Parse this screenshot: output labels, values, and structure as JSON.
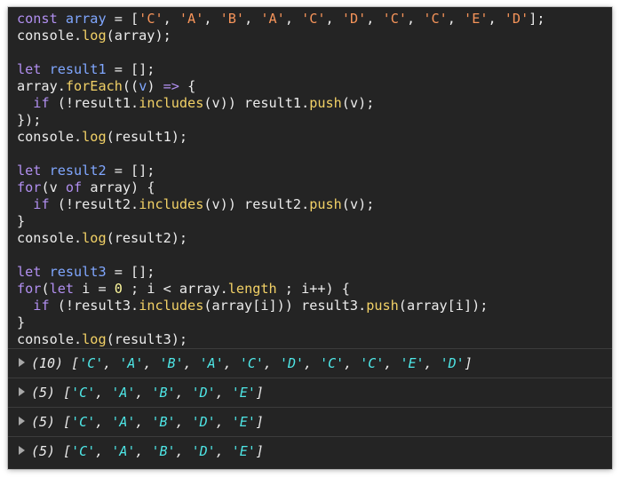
{
  "code_lines": [
    [
      {
        "t": "kw",
        "v": "const "
      },
      {
        "t": "var",
        "v": "array"
      },
      {
        "t": "txt",
        "v": " = ["
      },
      {
        "t": "str",
        "v": "'C'"
      },
      {
        "t": "txt",
        "v": ", "
      },
      {
        "t": "str",
        "v": "'A'"
      },
      {
        "t": "txt",
        "v": ", "
      },
      {
        "t": "str",
        "v": "'B'"
      },
      {
        "t": "txt",
        "v": ", "
      },
      {
        "t": "str",
        "v": "'A'"
      },
      {
        "t": "txt",
        "v": ", "
      },
      {
        "t": "str",
        "v": "'C'"
      },
      {
        "t": "txt",
        "v": ", "
      },
      {
        "t": "str",
        "v": "'D'"
      },
      {
        "t": "txt",
        "v": ", "
      },
      {
        "t": "str",
        "v": "'C'"
      },
      {
        "t": "txt",
        "v": ", "
      },
      {
        "t": "str",
        "v": "'C'"
      },
      {
        "t": "txt",
        "v": ", "
      },
      {
        "t": "str",
        "v": "'E'"
      },
      {
        "t": "txt",
        "v": ", "
      },
      {
        "t": "str",
        "v": "'D'"
      },
      {
        "t": "txt",
        "v": "];"
      }
    ],
    [
      {
        "t": "txt",
        "v": "console."
      },
      {
        "t": "fn",
        "v": "log"
      },
      {
        "t": "txt",
        "v": "(array);"
      }
    ],
    [],
    [
      {
        "t": "kw",
        "v": "let "
      },
      {
        "t": "var",
        "v": "result1"
      },
      {
        "t": "txt",
        "v": " = [];"
      }
    ],
    [
      {
        "t": "txt",
        "v": "array."
      },
      {
        "t": "fn",
        "v": "forEach"
      },
      {
        "t": "txt",
        "v": "(("
      },
      {
        "t": "var",
        "v": "v"
      },
      {
        "t": "txt",
        "v": ") "
      },
      {
        "t": "kw",
        "v": "=>"
      },
      {
        "t": "txt",
        "v": " {"
      }
    ],
    [
      {
        "t": "txt",
        "v": "  "
      },
      {
        "t": "kw",
        "v": "if"
      },
      {
        "t": "txt",
        "v": " (!result1."
      },
      {
        "t": "fn",
        "v": "includes"
      },
      {
        "t": "txt",
        "v": "(v)) result1."
      },
      {
        "t": "fn",
        "v": "push"
      },
      {
        "t": "txt",
        "v": "(v);"
      }
    ],
    [
      {
        "t": "txt",
        "v": "});"
      }
    ],
    [
      {
        "t": "txt",
        "v": "console."
      },
      {
        "t": "fn",
        "v": "log"
      },
      {
        "t": "txt",
        "v": "(result1);"
      }
    ],
    [],
    [
      {
        "t": "kw",
        "v": "let "
      },
      {
        "t": "var",
        "v": "result2"
      },
      {
        "t": "txt",
        "v": " = [];"
      }
    ],
    [
      {
        "t": "kw",
        "v": "for"
      },
      {
        "t": "txt",
        "v": "(v "
      },
      {
        "t": "kw",
        "v": "of"
      },
      {
        "t": "txt",
        "v": " array) {"
      }
    ],
    [
      {
        "t": "txt",
        "v": "  "
      },
      {
        "t": "kw",
        "v": "if"
      },
      {
        "t": "txt",
        "v": " (!result2."
      },
      {
        "t": "fn",
        "v": "includes"
      },
      {
        "t": "txt",
        "v": "(v)) result2."
      },
      {
        "t": "fn",
        "v": "push"
      },
      {
        "t": "txt",
        "v": "(v);"
      }
    ],
    [
      {
        "t": "txt",
        "v": "}"
      }
    ],
    [
      {
        "t": "txt",
        "v": "console."
      },
      {
        "t": "fn",
        "v": "log"
      },
      {
        "t": "txt",
        "v": "(result2);"
      }
    ],
    [],
    [
      {
        "t": "kw",
        "v": "let "
      },
      {
        "t": "var",
        "v": "result3"
      },
      {
        "t": "txt",
        "v": " = [];"
      }
    ],
    [
      {
        "t": "kw",
        "v": "for"
      },
      {
        "t": "txt",
        "v": "("
      },
      {
        "t": "kw",
        "v": "let"
      },
      {
        "t": "txt",
        "v": " i = "
      },
      {
        "t": "num",
        "v": "0"
      },
      {
        "t": "txt",
        "v": " ; i < array."
      },
      {
        "t": "fn",
        "v": "length"
      },
      {
        "t": "txt",
        "v": " ; i++) {"
      }
    ],
    [
      {
        "t": "txt",
        "v": "  "
      },
      {
        "t": "kw",
        "v": "if"
      },
      {
        "t": "txt",
        "v": " (!result3."
      },
      {
        "t": "fn",
        "v": "includes"
      },
      {
        "t": "txt",
        "v": "(array[i])) result3."
      },
      {
        "t": "fn",
        "v": "push"
      },
      {
        "t": "txt",
        "v": "(array[i]);"
      }
    ],
    [
      {
        "t": "txt",
        "v": "}"
      }
    ],
    [
      {
        "t": "txt",
        "v": "console."
      },
      {
        "t": "fn",
        "v": "log"
      },
      {
        "t": "txt",
        "v": "(result3);"
      }
    ]
  ],
  "console_output": [
    {
      "count": "(10)",
      "items": [
        "'C'",
        "'A'",
        "'B'",
        "'A'",
        "'C'",
        "'D'",
        "'C'",
        "'C'",
        "'E'",
        "'D'"
      ]
    },
    {
      "count": "(5)",
      "items": [
        "'C'",
        "'A'",
        "'B'",
        "'D'",
        "'E'"
      ]
    },
    {
      "count": "(5)",
      "items": [
        "'C'",
        "'A'",
        "'B'",
        "'D'",
        "'E'"
      ]
    },
    {
      "count": "(5)",
      "items": [
        "'C'",
        "'A'",
        "'B'",
        "'D'",
        "'E'"
      ]
    }
  ],
  "icons": {
    "expand": "expand-triangle-icon"
  },
  "colors": {
    "background": "#242424",
    "keyword": "#b18ff0",
    "variable": "#80a7ff",
    "string": "#f6945a",
    "number": "#fdf79d",
    "function": "#f2d166",
    "text": "#ececec",
    "output_string": "#4ee6e6"
  }
}
